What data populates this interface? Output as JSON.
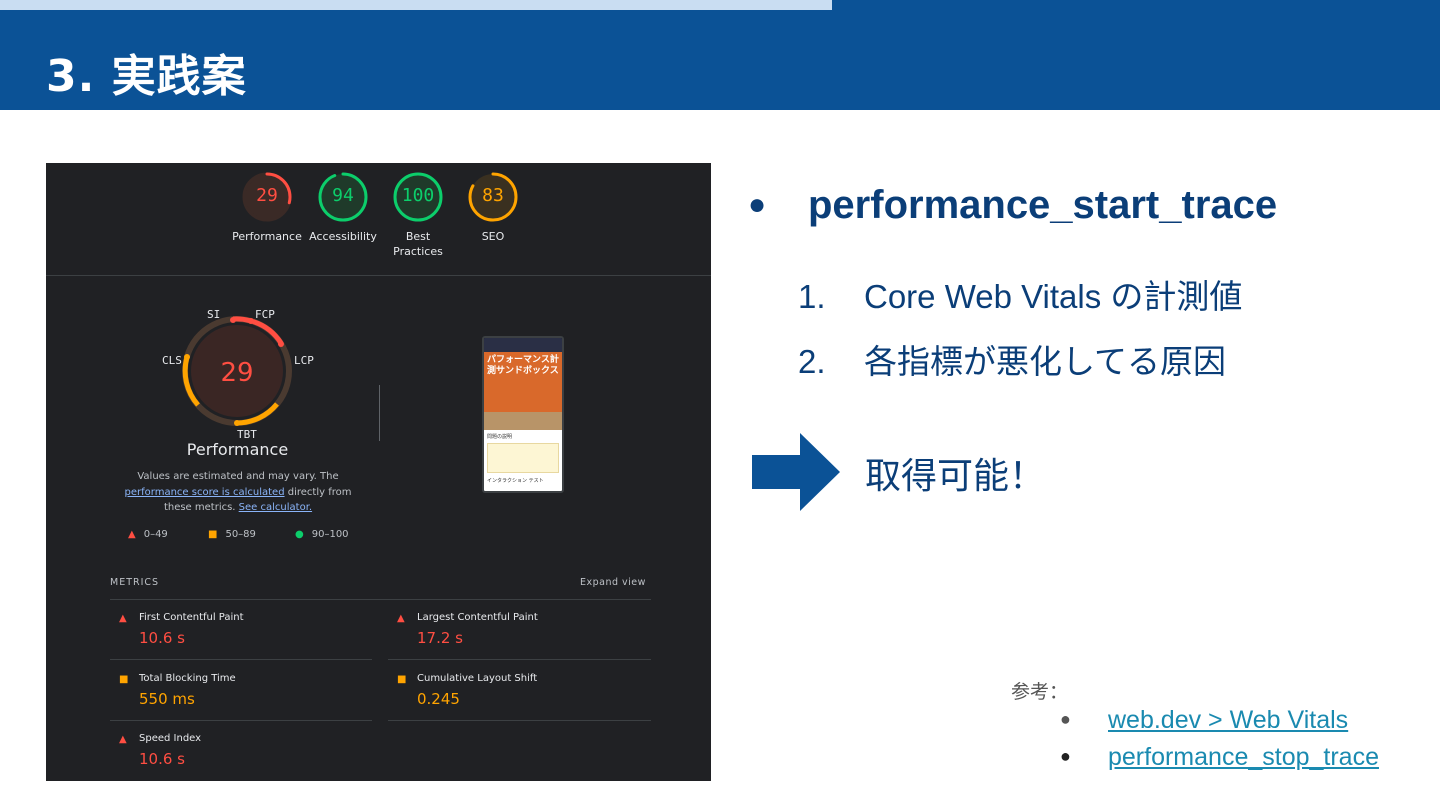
{
  "slide": {
    "title": "3. 実践案"
  },
  "lighthouse": {
    "categories": [
      {
        "score": "29",
        "label": "Performance",
        "level": 0.29,
        "color": "#ff4e42"
      },
      {
        "score": "94",
        "label": "Accessibility",
        "level": 0.94,
        "color": "#0cce6b"
      },
      {
        "score": "100",
        "label": "Best Practices",
        "level": 1.0,
        "color": "#0cce6b"
      },
      {
        "score": "83",
        "label": "SEO",
        "level": 0.83,
        "color": "#ffa400"
      }
    ],
    "main_score": "29",
    "radar_labels": {
      "si": "SI",
      "fcp": "FCP",
      "lcp": "LCP",
      "tbt": "TBT",
      "cls": "CLS"
    },
    "main_title": "Performance",
    "note_prefix": "Values are estimated and may vary. The ",
    "note_link1": "performance score is calculated",
    "note_middle": " directly from these metrics. ",
    "note_link2": "See calculator.",
    "legend": {
      "fail": "0–49",
      "average": "50–89",
      "pass": "90–100"
    },
    "preview": {
      "hero_text": "パフォーマンス計測サンドボックス",
      "section": "問題の説明",
      "section2": "インタラクション テスト"
    },
    "metrics_header": "METRICS",
    "expand_view": "Expand view",
    "metrics": [
      {
        "name": "First Contentful Paint",
        "value": "10.6 s",
        "status": "fail"
      },
      {
        "name": "Largest Contentful Paint",
        "value": "17.2 s",
        "status": "fail"
      },
      {
        "name": "Total Blocking Time",
        "value": "550 ms",
        "status": "average"
      },
      {
        "name": "Cumulative Layout Shift",
        "value": "0.245",
        "status": "average"
      },
      {
        "name": "Speed Index",
        "value": "10.6 s",
        "status": "fail"
      }
    ],
    "colors": {
      "fail": "#ff4e42",
      "average": "#ffa400",
      "pass": "#0cce6b"
    }
  },
  "content": {
    "bullet_symbol": "●",
    "main_bullet": "performance_start_trace",
    "sub_items": [
      {
        "num": "1.",
        "text": "Core Web Vitals の計測値"
      },
      {
        "num": "2.",
        "text": "各指標が悪化してる原因"
      }
    ],
    "result": "取得可能！"
  },
  "references": {
    "label": "参考：",
    "links": [
      {
        "text": "web.dev > Web Vitals"
      },
      {
        "text": "performance_stop_trace"
      }
    ]
  }
}
